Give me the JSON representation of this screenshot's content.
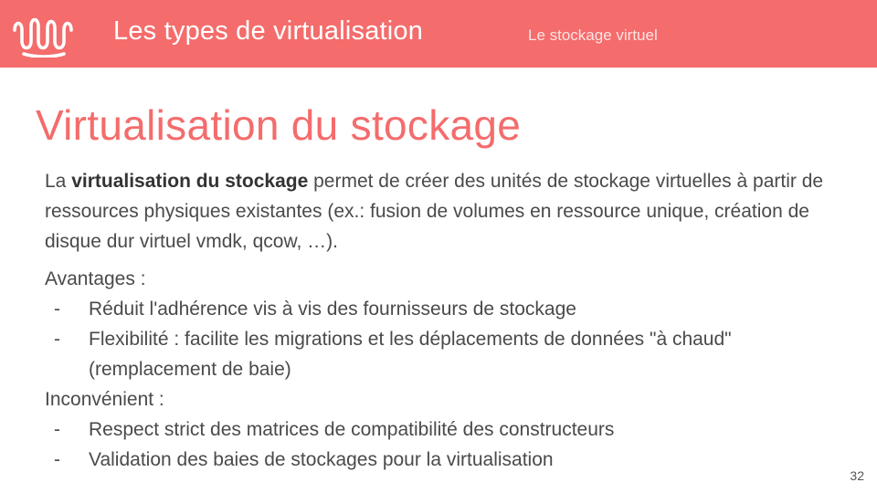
{
  "header": {
    "title": "Les types de virtualisation",
    "subtitle": "Le stockage virtuel",
    "logo_icon": "wave-logo-icon",
    "color": "#f46c6c"
  },
  "slide": {
    "title": "Virtualisation du stockage",
    "intro": {
      "prefix": "La ",
      "bold": "virtualisation du stockage",
      "suffix": " permet de créer des unités de stockage virtuelles à partir de ressources physiques existantes (ex.: fusion de volumes en ressource unique, création de disque dur virtuel vmdk, qcow, …)."
    },
    "advantages": {
      "label": "Avantages :",
      "items": [
        "Réduit l'adhérence vis à vis des fournisseurs de stockage",
        "Flexibilité : facilite les migrations et les déplacements de données \"à chaud\" (remplacement de baie)"
      ]
    },
    "drawbacks": {
      "label": "Inconvénient :",
      "items": [
        "Respect strict des matrices de compatibilité des constructeurs",
        "Validation des baies de stockages pour la virtualisation"
      ]
    },
    "bullet": "-",
    "page_number": "32"
  }
}
